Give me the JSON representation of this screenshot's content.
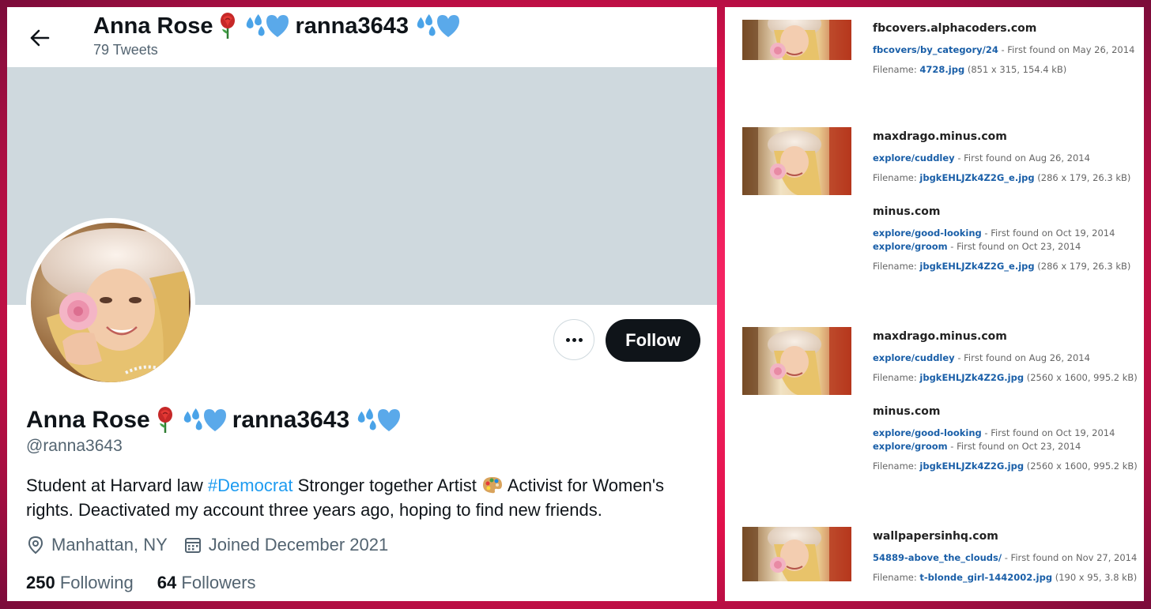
{
  "twitter": {
    "header_name": "Anna Rose",
    "header_handle_text": "ranna3643",
    "tweets_count": "79 Tweets",
    "display_name": "Anna Rose",
    "name_handle_text": "ranna3643",
    "handle": "@ranna3643",
    "follow_label": "Follow",
    "bio_part1": "Student at Harvard law ",
    "bio_hashtag": "#Democrat",
    "bio_part2": " Stronger together Artist ",
    "bio_part3": " Activist for Women's rights. Deactivated my account three years ago, hoping to find new friends.",
    "location": "Manhattan, NY",
    "joined": "Joined December 2021",
    "following_count": "250",
    "following_label": "Following",
    "followers_count": "64",
    "followers_label": "Followers",
    "accent_color": "#1d9bf0"
  },
  "results": [
    {
      "groups": [
        {
          "domain": "fbcovers.alphacoders.com",
          "links": [
            {
              "path": "fbcovers/by_category/24",
              "found": " - First found on May 26, 2014"
            }
          ],
          "filename_label": "Filename: ",
          "filename": "4728.jpg",
          "file_meta": " (851 x 315, 154.4 kB)"
        }
      ]
    },
    {
      "groups": [
        {
          "domain": "maxdrago.minus.com",
          "links": [
            {
              "path": "explore/cuddley",
              "found": " - First found on Aug 26, 2014"
            }
          ],
          "filename_label": "Filename: ",
          "filename": "jbgkEHLJZk4Z2G_e.jpg",
          "file_meta": " (286 x 179, 26.3 kB)"
        },
        {
          "domain": "minus.com",
          "links": [
            {
              "path": "explore/good-looking",
              "found": " - First found on Oct 19, 2014"
            },
            {
              "path": "explore/groom",
              "found": " - First found on Oct 23, 2014"
            }
          ],
          "filename_label": "Filename: ",
          "filename": "jbgkEHLJZk4Z2G_e.jpg",
          "file_meta": " (286 x 179, 26.3 kB)"
        }
      ]
    },
    {
      "groups": [
        {
          "domain": "maxdrago.minus.com",
          "links": [
            {
              "path": "explore/cuddley",
              "found": " - First found on Aug 26, 2014"
            }
          ],
          "filename_label": "Filename: ",
          "filename": "jbgkEHLJZk4Z2G.jpg",
          "file_meta": " (2560 x 1600, 995.2 kB)"
        },
        {
          "domain": "minus.com",
          "links": [
            {
              "path": "explore/good-looking",
              "found": " - First found on Oct 19, 2014"
            },
            {
              "path": "explore/groom",
              "found": " - First found on Oct 23, 2014"
            }
          ],
          "filename_label": "Filename: ",
          "filename": "jbgkEHLJZk4Z2G.jpg",
          "file_meta": " (2560 x 1600, 995.2 kB)"
        }
      ]
    },
    {
      "groups": [
        {
          "domain": "wallpapersinhq.com",
          "links": [
            {
              "path": "54889-above_the_clouds/",
              "found": " - First found on Nov 27, 2014"
            }
          ],
          "filename_label": "Filename: ",
          "filename": "t-blonde_girl-1442002.jpg",
          "file_meta": " (190 x 95, 3.8 kB)"
        }
      ]
    }
  ]
}
